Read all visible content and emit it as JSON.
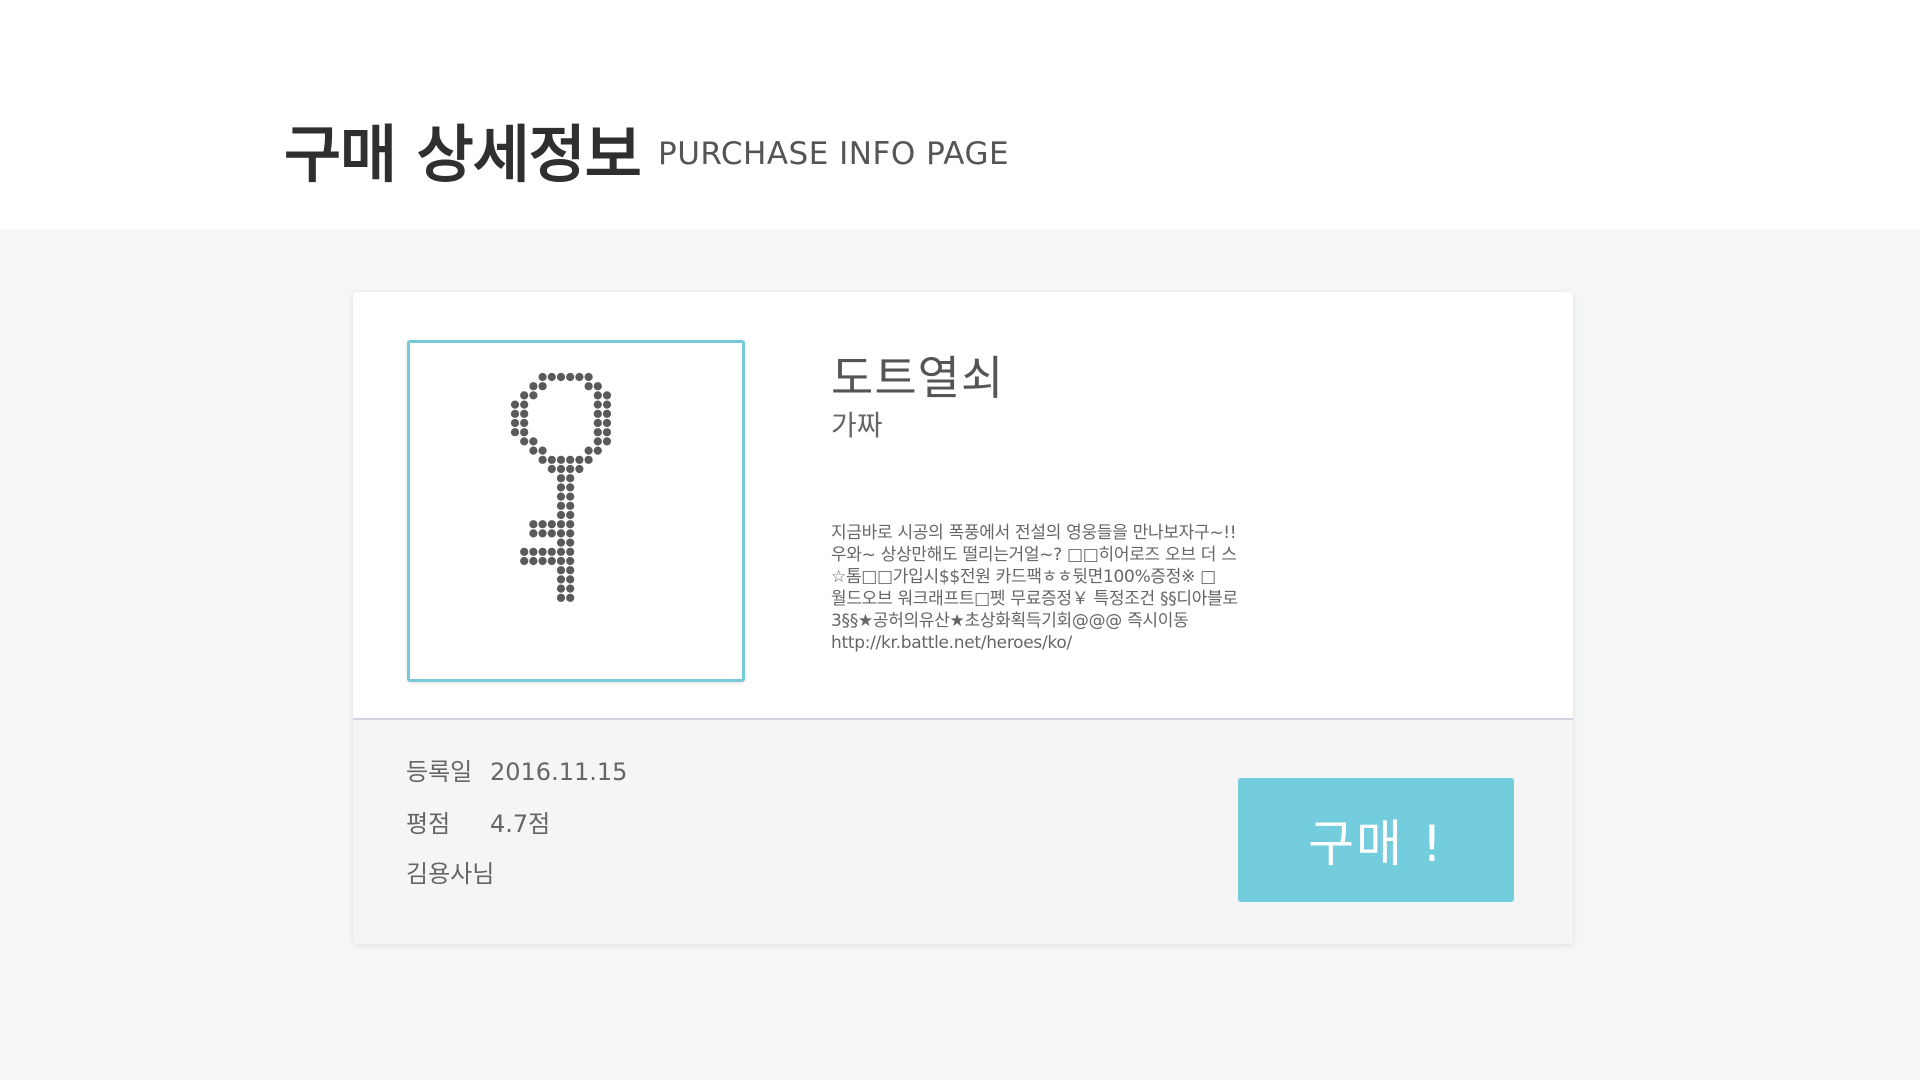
{
  "header": {
    "title": "구매 상세정보",
    "subtitle": "PURCHASE INFO PAGE"
  },
  "product": {
    "name": "도트열쇠",
    "subtitle": "가짜",
    "description": "지금바로 시공의 폭풍에서 전설의 영웅들을 만나보자구~!!\n우와~ 상상만해도 떨리는거얼~? □□히어로즈 오브 더 스\n☆톰□□가입시$$전원 카드팩ㅎㅎ뒷면100%증정※ □\n월드오브 워크래프트□펫 무료증정￥ 특정조건 §§디아블로\n3§§★공허의유산★초상화획득기회@@@ 즉시이동\nhttp://kr.battle.net/heroes/ko/",
    "image_icon": "dot-key-icon"
  },
  "meta": {
    "date_label": "등록일",
    "date_value": "2016.11.15",
    "rating_label": "평점",
    "rating_value": "4.7점",
    "seller": "김용사님"
  },
  "actions": {
    "buy_label": "구매 !"
  },
  "colors": {
    "accent": "#74cddc",
    "frame": "#76cad9",
    "dot": "#5a5a5a"
  }
}
